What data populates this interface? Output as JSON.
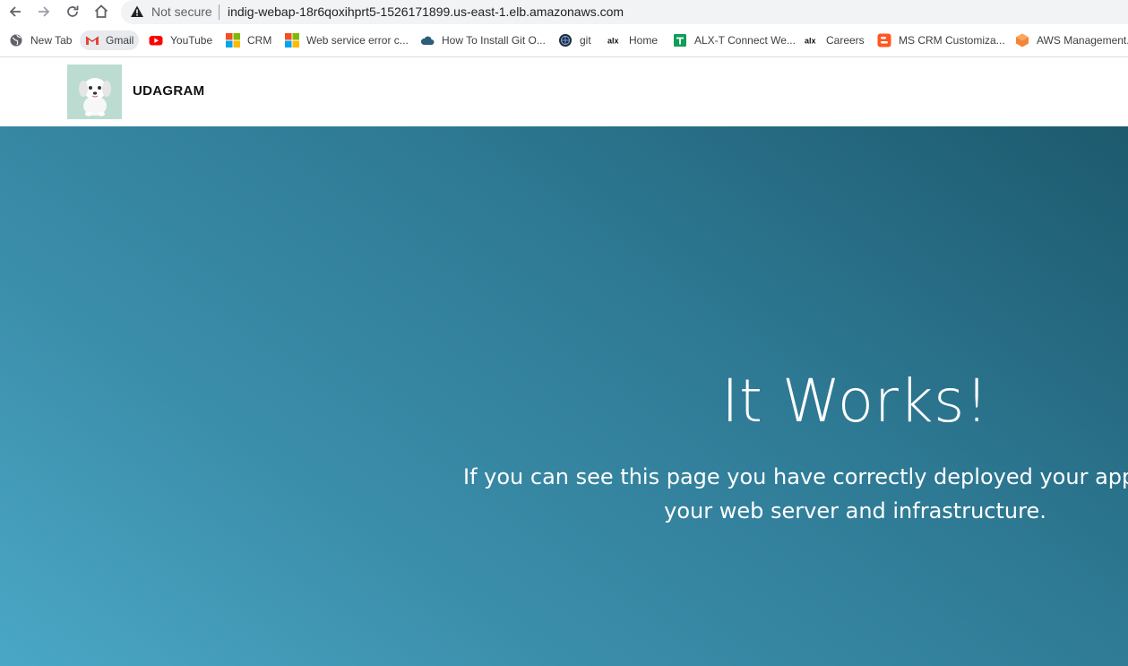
{
  "browser": {
    "security_label": "Not secure",
    "url": "indig-webap-18r6qoxihprt5-1526171899.us-east-1.elb.amazonaws.com",
    "bookmarks": [
      {
        "label": "New Tab",
        "icon": "globe-icon"
      },
      {
        "label": "Gmail",
        "icon": "gmail-icon"
      },
      {
        "label": "YouTube",
        "icon": "youtube-icon"
      },
      {
        "label": "CRM",
        "icon": "microsoft-icon"
      },
      {
        "label": "Web service error c...",
        "icon": "microsoft-icon"
      },
      {
        "label": "How To Install Git O...",
        "icon": "cloud-icon"
      },
      {
        "label": "git",
        "icon": "globe-icon"
      },
      {
        "label": "Home",
        "icon": "alx-icon"
      },
      {
        "label": "ALX-T Connect We...",
        "icon": "sheets-icon"
      },
      {
        "label": "Careers",
        "icon": "alx-icon"
      },
      {
        "label": "MS CRM Customiza...",
        "icon": "blogger-icon"
      },
      {
        "label": "AWS Management...",
        "icon": "aws-icon"
      }
    ]
  },
  "site": {
    "brand": "UDAGRAM",
    "hero_title": "It Works!",
    "hero_line1": "If you can see this page you have correctly deployed your application on",
    "hero_line2": "your web server and infrastructure."
  },
  "colors": {
    "hero_gradient_start": "#4aa7c6",
    "hero_gradient_end": "#1d5a6e",
    "logo_bg": "#bcdcd1"
  }
}
